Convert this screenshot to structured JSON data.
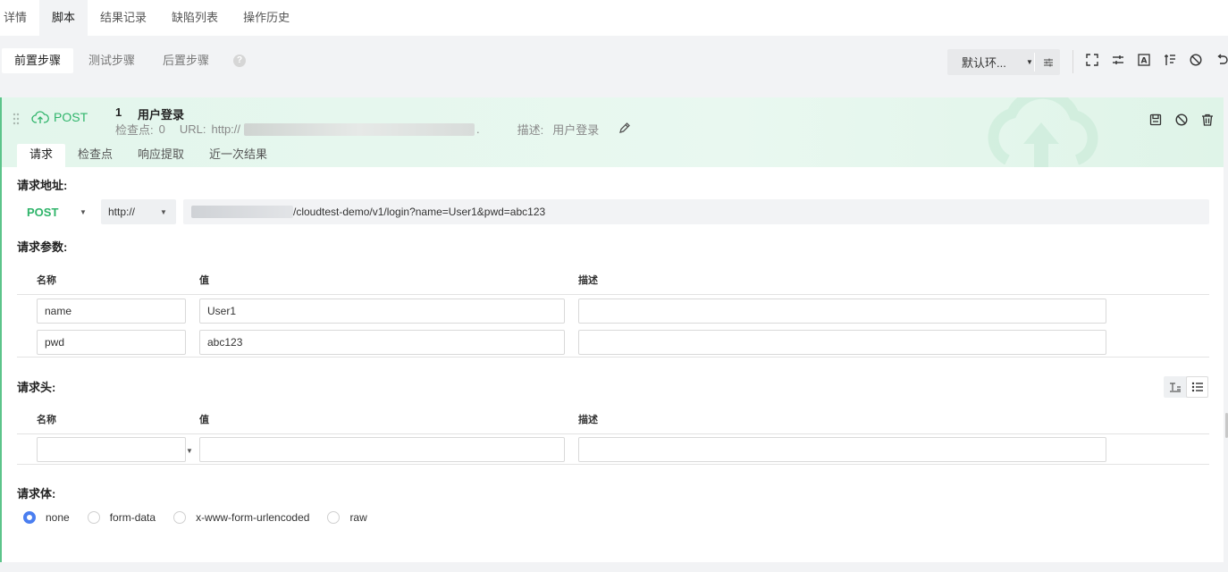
{
  "top_tabs": [
    {
      "label": "详情"
    },
    {
      "label": "脚本",
      "active": true
    },
    {
      "label": "结果记录"
    },
    {
      "label": "缺陷列表"
    },
    {
      "label": "操作历史"
    }
  ],
  "step_phases": [
    {
      "label": "前置步骤",
      "active": true
    },
    {
      "label": "测试步骤"
    },
    {
      "label": "后置步骤"
    }
  ],
  "environment": {
    "selected": "默认环..."
  },
  "toolbar_icons": [
    "fullscreen-icon",
    "adjust-icon",
    "text-format-icon",
    "list-indent-icon",
    "disable-icon",
    "undo-icon"
  ],
  "step": {
    "method": "POST",
    "number": "1",
    "name": "用户登录",
    "checkpoints_label": "检查点:",
    "checkpoints_count": "0",
    "url_label": "URL:",
    "url_prefix": "http://",
    "url_suffix": ".",
    "desc_label": "描述:",
    "desc_value": "用户登录",
    "accent_color": "#2fb46a"
  },
  "sub_tabs": [
    {
      "label": "请求",
      "active": true
    },
    {
      "label": "检查点"
    },
    {
      "label": "响应提取"
    },
    {
      "label": "近一次结果"
    }
  ],
  "request": {
    "address_label": "请求地址:",
    "method": "POST",
    "protocol": "http://",
    "url_path": "/cloudtest-demo/v1/login?name=User1&pwd=abc123",
    "params_label": "请求参数:",
    "params_columns": [
      "名称",
      "值",
      "描述"
    ],
    "params": [
      {
        "name": "name",
        "value": "User1",
        "desc": ""
      },
      {
        "name": "pwd",
        "value": "abc123",
        "desc": ""
      }
    ],
    "headers_label": "请求头:",
    "headers_columns": [
      "名称",
      "值",
      "描述"
    ],
    "headers": [
      {
        "name": "",
        "value": "",
        "desc": ""
      }
    ],
    "body_label": "请求体:",
    "body_types": [
      {
        "label": "none",
        "checked": true
      },
      {
        "label": "form-data"
      },
      {
        "label": "x-www-form-urlencoded"
      },
      {
        "label": "raw"
      }
    ]
  }
}
